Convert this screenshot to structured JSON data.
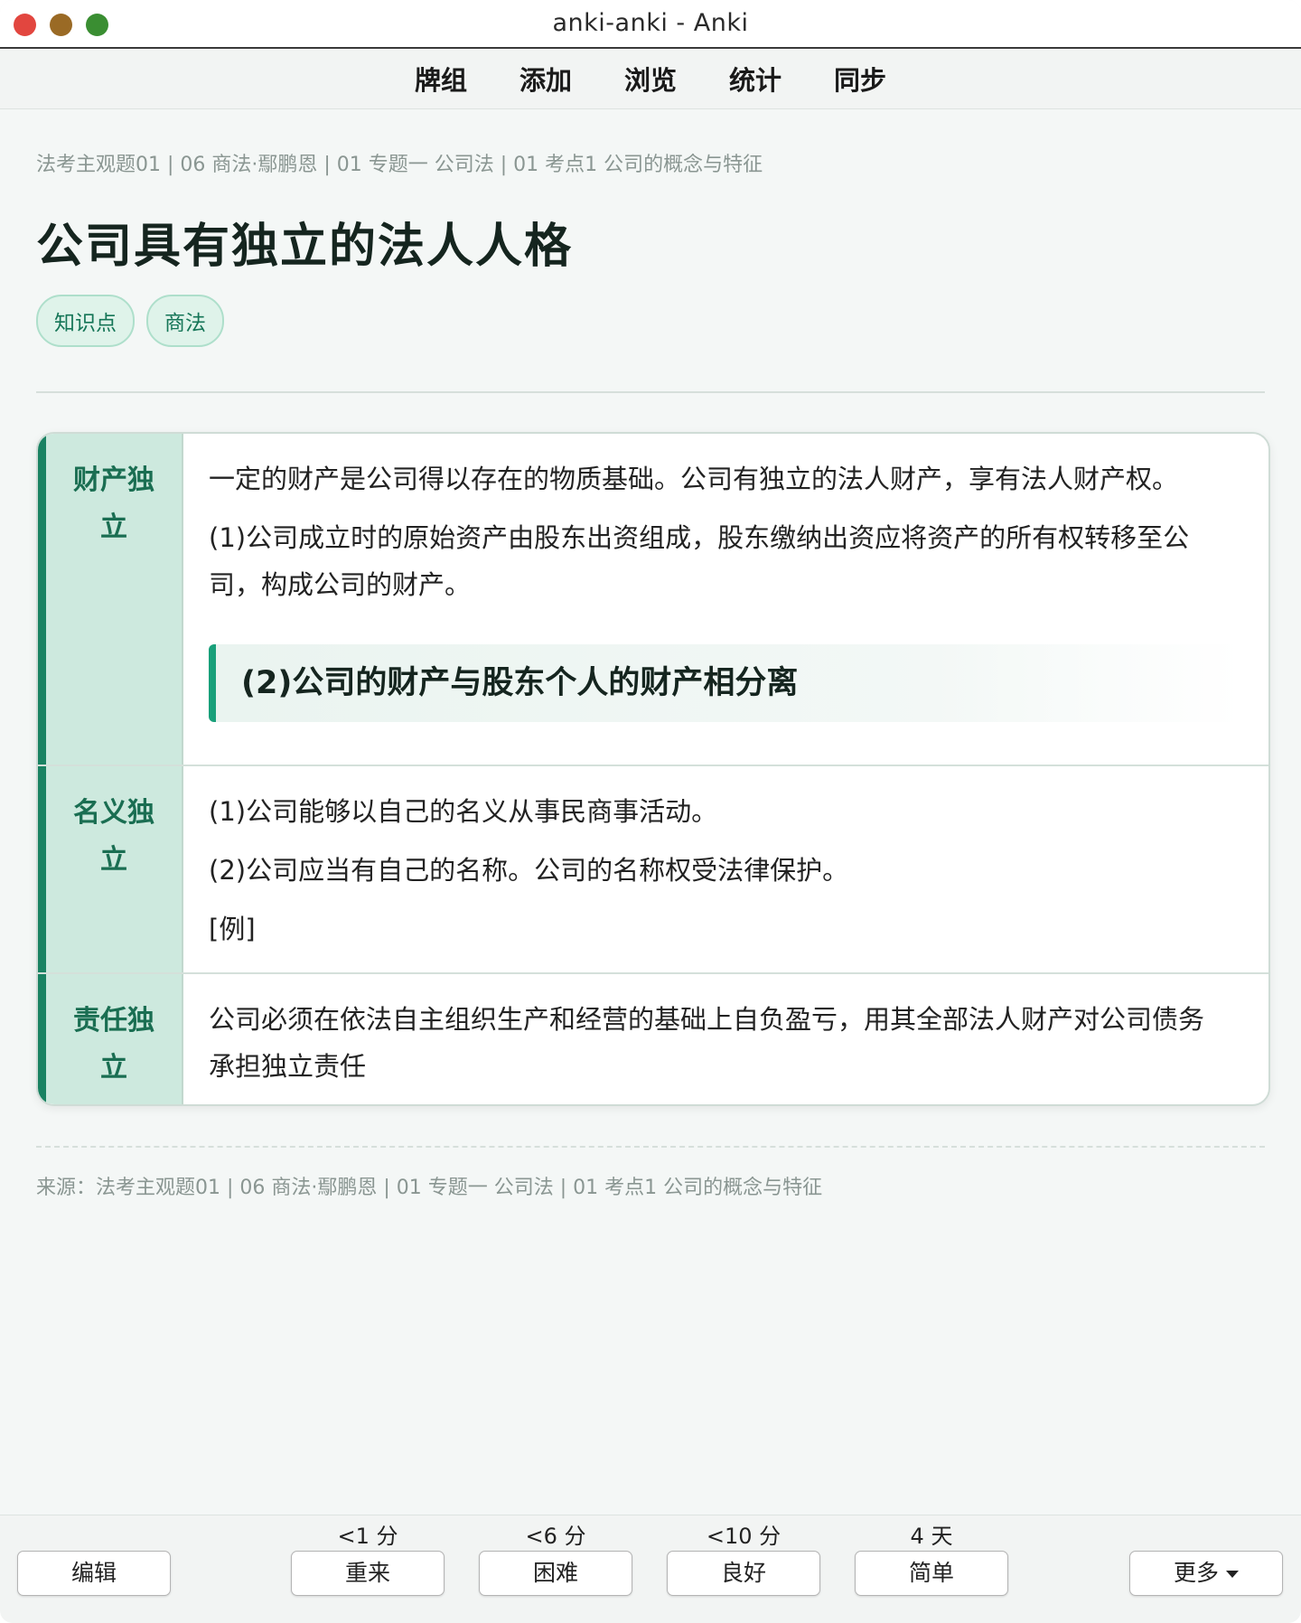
{
  "window": {
    "title": "anki-anki - Anki"
  },
  "menu": {
    "items": [
      "牌组",
      "添加",
      "浏览",
      "统计",
      "同步"
    ]
  },
  "card": {
    "breadcrumb": "法考主观题01 | 06 商法·鄢鹏恩 | 01 专题一 公司法 | 01 考点1 公司的概念与特征",
    "title": "公司具有独立的法人人格",
    "tags": [
      "知识点",
      "商法"
    ],
    "rows": [
      {
        "head": [
          "财产独",
          "立"
        ],
        "paragraphs": [
          "一定的财产是公司得以存在的物质基础。公司有独立的法人财产，享有法人财产权。",
          "(1)公司成立时的原始资产由股东出资组成，股东缴纳出资应将资产的所有权转移至公",
          "司，构成公司的财产。"
        ],
        "callout": "(2)公司的财产与股东个人的财产相分离"
      },
      {
        "head": [
          "名义独",
          "立"
        ],
        "paragraphs": [
          "(1)公司能够以自己的名义从事民商事活动。",
          "(2)公司应当有自己的名称。公司的名称权受法律保护。",
          "[例]"
        ]
      },
      {
        "head": [
          "责任独",
          "立"
        ],
        "paragraphs": [
          "公司必须在依法自主组织生产和经营的基础上自负盈亏，用其全部法人财产对公司债务",
          "承担独立责任"
        ]
      }
    ],
    "source": "来源：法考主观题01 | 06 商法·鄢鹏恩 | 01 专题一 公司法 | 01 考点1 公司的概念与特征"
  },
  "bottom": {
    "edit_label": "编辑",
    "answers": [
      {
        "label": "重来",
        "time": "<1 分"
      },
      {
        "label": "困难",
        "time": "<6 分"
      },
      {
        "label": "良好",
        "time": "<10 分"
      },
      {
        "label": "简单",
        "time": "4 天"
      }
    ],
    "more_label": "更多"
  },
  "colors": {
    "accent": "#1a8262",
    "tag_bg": "#dff3ea",
    "head_bg": "#cde9de",
    "callout_border": "#19a07a"
  }
}
